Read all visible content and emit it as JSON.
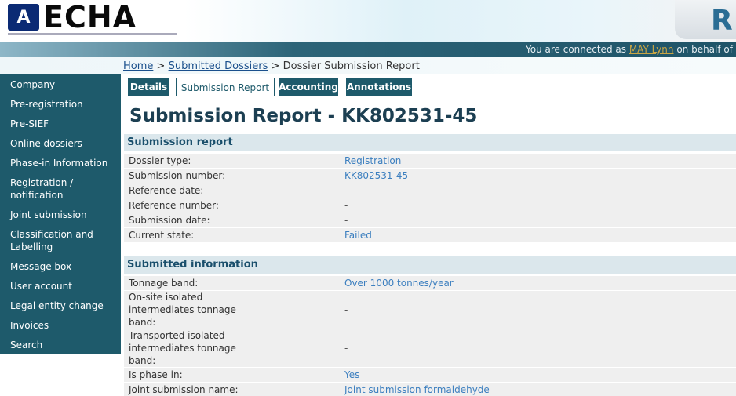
{
  "header": {
    "logo_mark": "A",
    "logo_text": "ECHA",
    "corner_letter": "R"
  },
  "connection": {
    "prefix": "You are connected as",
    "user": "MAY Lynn",
    "suffix": "on behalf of"
  },
  "breadcrumb": {
    "home": "Home",
    "sep1": ">",
    "submitted": "Submitted Dossiers",
    "sep2": ">",
    "current": "Dossier Submission Report"
  },
  "sidebar": {
    "items": [
      "Company",
      "Pre-registration",
      "Pre-SIEF",
      "Online dossiers",
      "Phase-in Information",
      "Registration / notification",
      "Joint submission",
      "Classification and Labelling",
      "Message box",
      "User account",
      "Legal entity change",
      "Invoices",
      "Search"
    ]
  },
  "tabs": [
    "Details",
    "Submission Report",
    "Accounting",
    "Annotations"
  ],
  "page_title": "Submission Report - KK802531-45",
  "submission_report": {
    "heading": "Submission report",
    "rows": [
      {
        "label": "Dossier type:",
        "value": "Registration"
      },
      {
        "label": "Submission number:",
        "value": "KK802531-45"
      },
      {
        "label": "Reference date:",
        "value": "-"
      },
      {
        "label": "Reference number:",
        "value": "-"
      },
      {
        "label": "Submission date:",
        "value": "-"
      },
      {
        "label": "Current state:",
        "value": "Failed"
      }
    ]
  },
  "submitted_information": {
    "heading": "Submitted information",
    "rows": [
      {
        "label": "Tonnage band:",
        "value": "Over 1000 tonnes/year"
      },
      {
        "label": "On-site isolated intermediates tonnage band:",
        "value": "-"
      },
      {
        "label": "Transported isolated intermediates tonnage band:",
        "value": "-"
      },
      {
        "label": "Is phase in:",
        "value": "Yes"
      },
      {
        "label": "Joint submission name:",
        "value": "Joint submission formaldehyde"
      }
    ]
  },
  "colors": {
    "sidebar_bg": "#1e5a6b",
    "link": "#3c7fbf",
    "section_bg": "#dbe7ec",
    "row_bg": "#efefef"
  }
}
